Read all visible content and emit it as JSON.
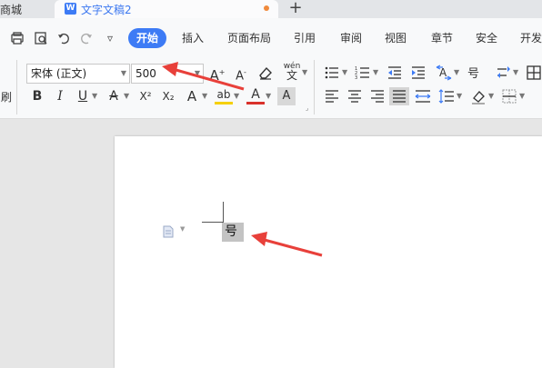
{
  "tabbar": {
    "left_tab_label": "商城",
    "active_tab": {
      "badge": "W",
      "title": "文字文稿2"
    },
    "new_tab_label": "+"
  },
  "quick_access": {
    "icons": [
      "save-icon",
      "print-preview-icon",
      "undo-icon",
      "redo-icon",
      "more-icon"
    ],
    "more_glyph": "▿"
  },
  "menu": {
    "items": [
      {
        "label": "开始",
        "active": true
      },
      {
        "label": "插入"
      },
      {
        "label": "页面布局"
      },
      {
        "label": "引用"
      },
      {
        "label": "审阅"
      },
      {
        "label": "视图"
      },
      {
        "label": "章节"
      },
      {
        "label": "安全"
      },
      {
        "label": "开发"
      }
    ]
  },
  "ribbon": {
    "font_name": "宋体 (正文)",
    "font_size": "500",
    "grow_font": "A",
    "shrink_font": "A",
    "phonetic": "wén",
    "bold": "B",
    "italic": "I",
    "underline": "U",
    "strike": "A",
    "superscript": "X²",
    "subscript": "X₂",
    "text_effect": "A",
    "highlight": "ab",
    "font_color": "A",
    "char_shade": "A",
    "left_edge_label": "刷"
  },
  "document": {
    "selected_text": "号"
  },
  "colors": {
    "accent": "#3d7bf5",
    "arrow": "#e8403a",
    "highlight": "#f5d000",
    "font_red": "#d9312b"
  }
}
